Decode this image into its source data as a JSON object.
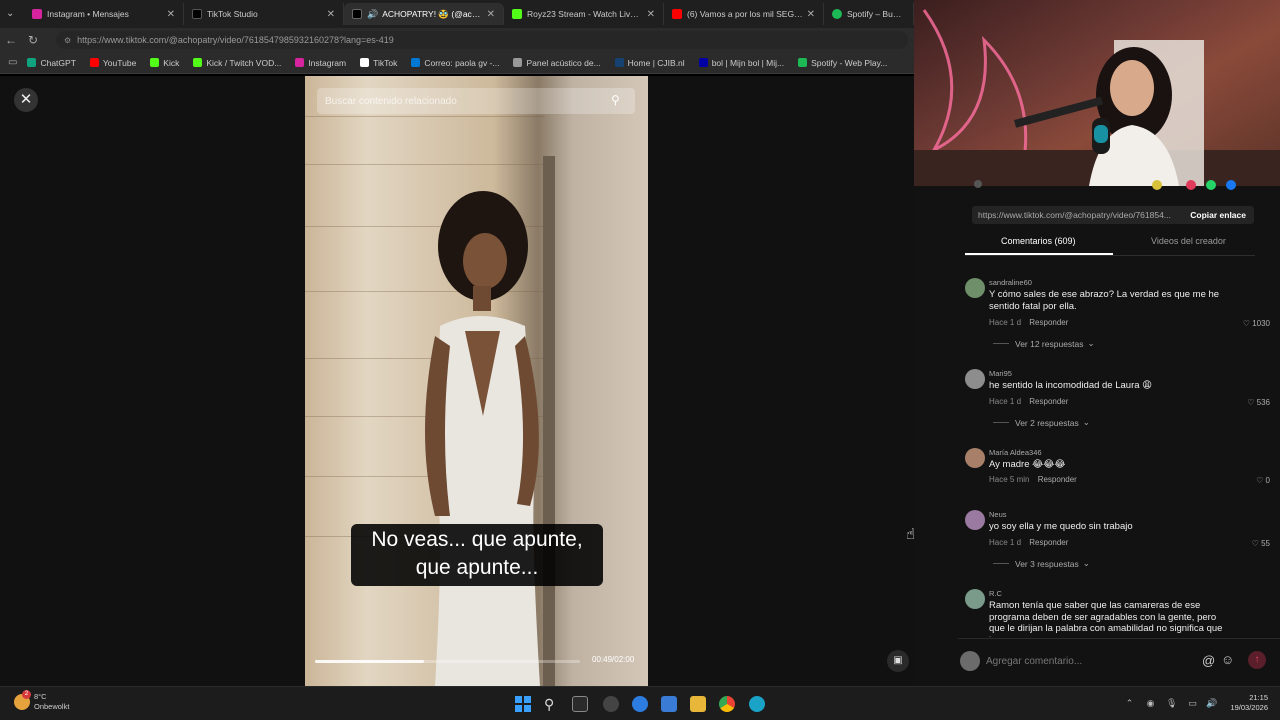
{
  "browser": {
    "tabs": [
      {
        "label": "Instagram • Mensajes",
        "color": "#d6249f"
      },
      {
        "label": "TikTok Studio",
        "color": "#111111"
      },
      {
        "label": "ACHOPATRY! 🥸 (@achopatr",
        "color": "#111111"
      },
      {
        "label": "Royz23 Stream - Watch Live on Ki",
        "color": "#53fc18"
      },
      {
        "label": "(6) Vamos a por los mil SEGUIDOR",
        "color": "#ff0000"
      },
      {
        "label": "Spotify – Buscar",
        "color": "#1db954"
      }
    ],
    "url": "https://www.tiktok.com/@achopatry/video/7618547985932160278?lang=es-419",
    "bookmarks": [
      {
        "label": "ChatGPT",
        "color": "#10a37f"
      },
      {
        "label": "YouTube",
        "color": "#ff0000"
      },
      {
        "label": "Kick",
        "color": "#53fc18"
      },
      {
        "label": "Kick / Twitch VOD...",
        "color": "#53fc18"
      },
      {
        "label": "Instagram",
        "color": "#d6249f"
      },
      {
        "label": "TikTok",
        "color": "#ffffff"
      },
      {
        "label": "Correo: paola gv -...",
        "color": "#0078d4"
      },
      {
        "label": "Panel acústico de...",
        "color": "#999999"
      },
      {
        "label": "Home | CJIB.nl",
        "color": "#154273"
      },
      {
        "label": "bol | Mijn bol | Mij...",
        "color": "#0000a4"
      },
      {
        "label": "Spotify - Web Play...",
        "color": "#1db954"
      }
    ]
  },
  "video": {
    "search_placeholder": "Buscar contenido relacionado",
    "caption_line1": "No veas... que apunte,",
    "caption_line2": "que apunte...",
    "timecode": "00:49/02:00",
    "progress": 0.41
  },
  "panel": {
    "share_url": "https://www.tiktok.com/@achopatry/video/761854...",
    "copy_label": "Copiar enlace",
    "tab_comments": "Comentarios (609)",
    "tab_creator": "Videos del creador",
    "comments": [
      {
        "user": "sandraline60",
        "text": "Y cómo sales de ese abrazo? La verdad es que me he sentido fatal por ella.",
        "time": "Hace 1 d",
        "reply": "Responder",
        "likes": "1030",
        "replies": "Ver 12 respuestas",
        "avatar": "#6f8f6a"
      },
      {
        "user": "Mari95",
        "text": "he sentido la incomodidad de Laura 😩",
        "time": "Hace 1 d",
        "reply": "Responder",
        "likes": "536",
        "replies": "Ver 2 respuestas",
        "avatar": "#8d8d8d"
      },
      {
        "user": "María Aldea346",
        "text": "Ay madre 😂😂😂",
        "time": "Hace 5 min",
        "reply": "Responder",
        "likes": "0",
        "replies": "",
        "avatar": "#a8806a"
      },
      {
        "user": "Neus",
        "text": "yo soy ella y me quedo sin trabajo",
        "time": "Hace 1 d",
        "reply": "Responder",
        "likes": "55",
        "replies": "Ver 3 respuestas",
        "avatar": "#9a7aa0"
      },
      {
        "user": "R.C",
        "text": "Ramon tenía que saber que las camareras de ese programa deben de ser agradables con la gente, pero que le dirijan la palabra con amabilidad no significa que haya",
        "time": "",
        "reply": "",
        "likes": "",
        "replies": "",
        "avatar": "#7a9a8a"
      }
    ],
    "comment_placeholder": "Agregar comentario..."
  },
  "taskbar": {
    "temperature": "8°C",
    "weather_text": "Onbewolkt",
    "time": "21:15",
    "date": "19/03/2026",
    "notification_count": "2"
  }
}
